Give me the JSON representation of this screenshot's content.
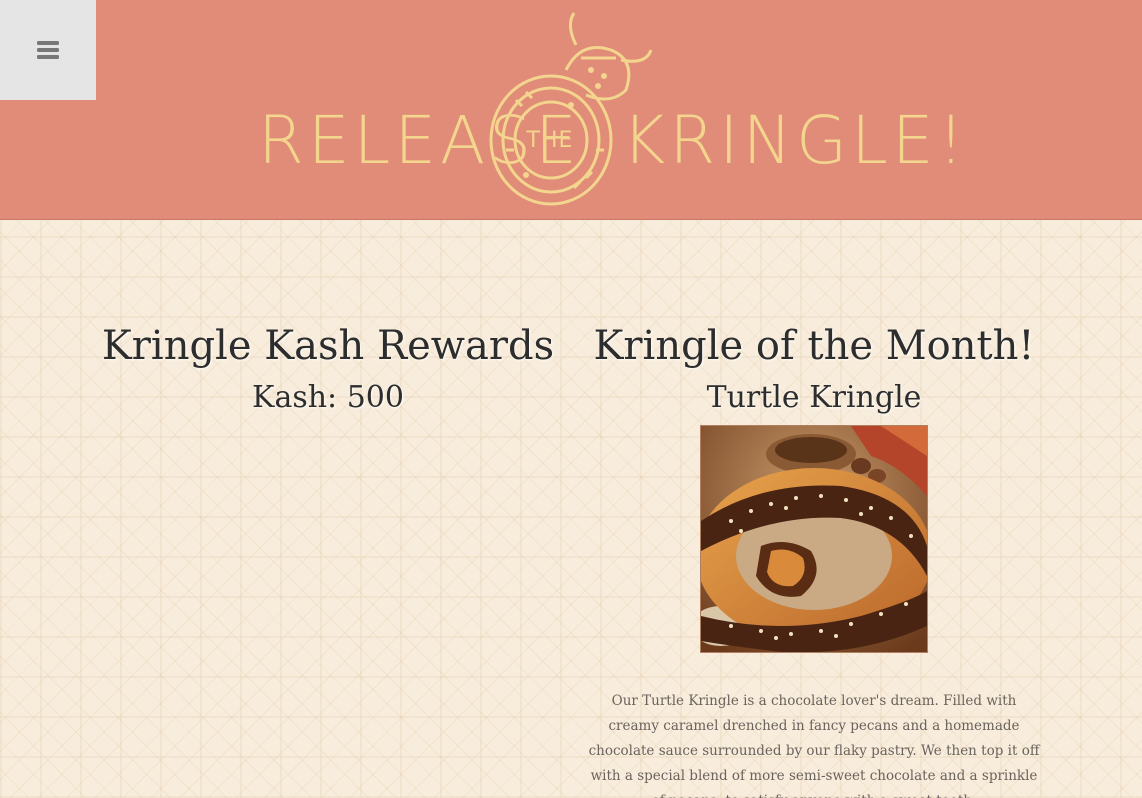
{
  "header": {
    "logo_left": "RELEASE",
    "logo_the": "THE",
    "logo_right": "KRINGLE!",
    "menu_icon": "hamburger-menu-icon",
    "background_color": "#e08c78",
    "logo_color": "#f3d58e"
  },
  "rewards": {
    "title": "Kringle Kash Rewards",
    "kash_label": "Kash: 500"
  },
  "featured": {
    "title": "Kringle of the Month!",
    "product_name": "Turtle Kringle",
    "image_alt": "Turtle Kringle",
    "description": "Our Turtle Kringle is a chocolate lover's dream. Filled with creamy caramel drenched in fancy pecans and a homemade chocolate sauce surrounded by our flaky pastry. We then top it off with a special blend of more semi-sweet chocolate and a sprinkle of pecans, to satisfy anyone with a sweet tooth."
  }
}
